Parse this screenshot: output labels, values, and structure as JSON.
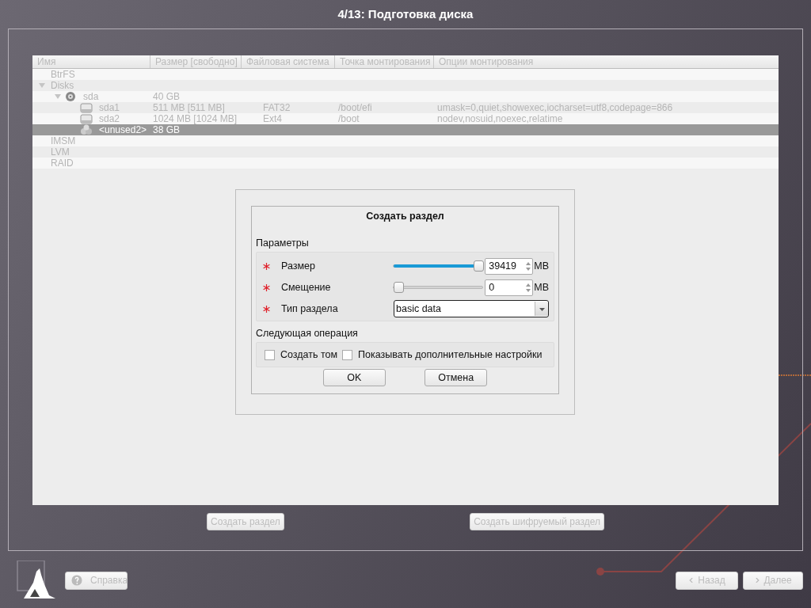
{
  "window": {
    "title": "4/13: Подготовка диска"
  },
  "table": {
    "columns": [
      "Имя",
      "Размер [свободно]",
      "Файловая система",
      "Точка монтирования",
      "Опции монтирования"
    ],
    "rows": [
      {
        "name": "BtrFS",
        "selected": false
      },
      {
        "name": "Disks",
        "selected": false,
        "expanded": true,
        "children": [
          {
            "kind": "disk",
            "name": "sda",
            "size": "40 GB",
            "selected": false,
            "expanded": true,
            "children": [
              {
                "kind": "partition",
                "name": "sda1",
                "size": "511 MB [511 MB]",
                "filesystem": "FAT32",
                "mount_point": "/boot/efi",
                "mount_options": "umask=0,quiet,showexec,iocharset=utf8,codepage=866",
                "selected": false
              },
              {
                "kind": "partition",
                "name": "sda2",
                "size": "1024 MB [1024 MB]",
                "filesystem": "Ext4",
                "mount_point": "/boot",
                "mount_options": "nodev,nosuid,noexec,relatime",
                "selected": false
              },
              {
                "kind": "free",
                "name": "<unused2>",
                "size": "38 GB",
                "selected": true
              }
            ]
          }
        ]
      },
      {
        "name": "IMSM",
        "selected": false
      },
      {
        "name": "LVM",
        "selected": false
      },
      {
        "name": "RAID",
        "selected": false
      }
    ]
  },
  "actions": [
    "Создать раздел",
    "Создать шифруемый раздел"
  ],
  "dialog": {
    "title": "Создать раздел",
    "parameters_label": "Параметры",
    "parameters": [
      {
        "kind": "slider",
        "label": "Размер",
        "required": true,
        "level": 1.0,
        "value": "39419",
        "unit": "MB"
      },
      {
        "kind": "slider",
        "label": "Смещение",
        "required": true,
        "level": 0.0,
        "value": "0",
        "unit": "MB"
      },
      {
        "kind": "combo",
        "label": "Тип раздела",
        "required": true,
        "value": "basic data"
      }
    ],
    "next_label": "Следующая операция",
    "options": [
      {
        "label": "Создать том",
        "checked": false
      },
      {
        "label": "Показывать дополнительные настройки",
        "checked": false
      }
    ],
    "buttons": [
      "OK",
      "Отмена"
    ]
  },
  "footer": {
    "help": "Справка",
    "back": "Назад",
    "next": "Далее"
  }
}
